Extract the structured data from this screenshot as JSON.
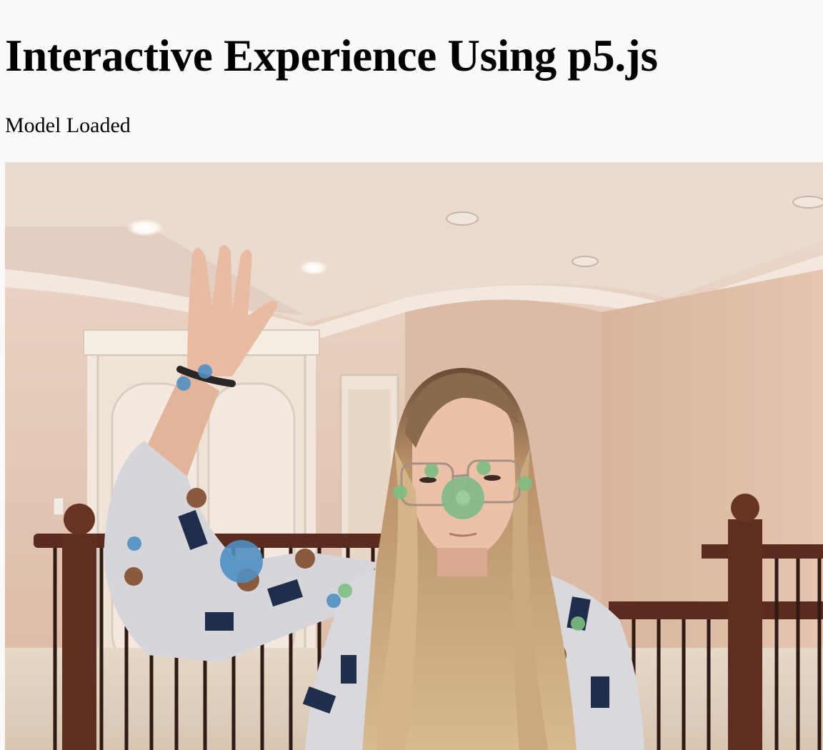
{
  "header": {
    "title": "Interactive Experience Using p5.js"
  },
  "status": {
    "text": "Model Loaded"
  },
  "sketch": {
    "description_icon": "webcam-video-feed",
    "colors": {
      "wall": "#e3c4b0",
      "ceiling": "#ecd9cc",
      "door": "#efe4da",
      "railing": "#5a2e22",
      "sweater": "#d8d8dc",
      "hair": "#c8a574",
      "skin": "#e6b9a0",
      "blue_marker": "#4f8fc2",
      "green_marker": "#7dbe82",
      "big_green_marker": "#82bb8a"
    }
  }
}
